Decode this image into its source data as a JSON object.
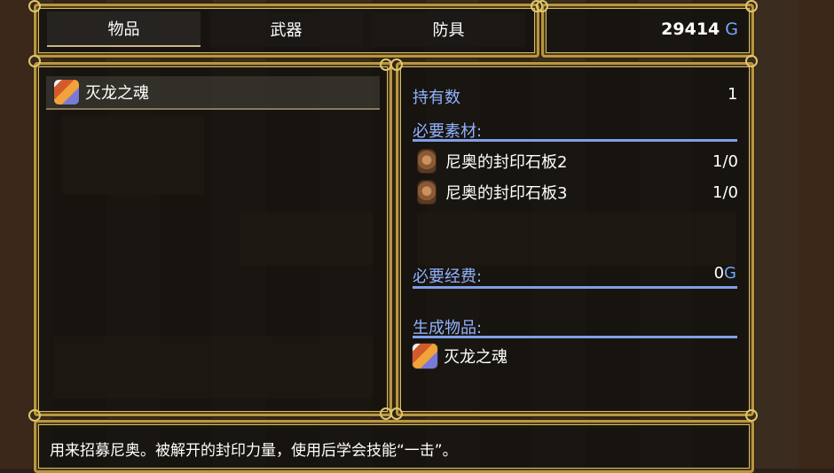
{
  "tabs": [
    {
      "label": "物品",
      "active": true
    },
    {
      "label": "武器",
      "active": false
    },
    {
      "label": "防具",
      "active": false
    }
  ],
  "gold": {
    "amount": "29414",
    "unit": "G"
  },
  "selected_item": {
    "name": "灭龙之魂",
    "icon": "dragon-soul-icon"
  },
  "details": {
    "owned_label": "持有数",
    "owned_value": "1",
    "materials_label": "必要素材:",
    "materials": [
      {
        "name": "尼奥的封印石板2",
        "count": "1/0",
        "icon": "stone-tablet-icon"
      },
      {
        "name": "尼奥的封印石板3",
        "count": "1/0",
        "icon": "stone-tablet-icon"
      }
    ],
    "cost_label": "必要经费:",
    "cost_value": "0",
    "cost_unit": "G",
    "result_label": "生成物品:",
    "result_item": {
      "name": "灭龙之魂",
      "icon": "dragon-soul-icon"
    }
  },
  "description": "用来招募尼奥。被解开的封印力量，使用后学会技能“一击”。",
  "colors": {
    "accent_blue": "#8fb3ff",
    "frame_gold": "#b8963f"
  }
}
